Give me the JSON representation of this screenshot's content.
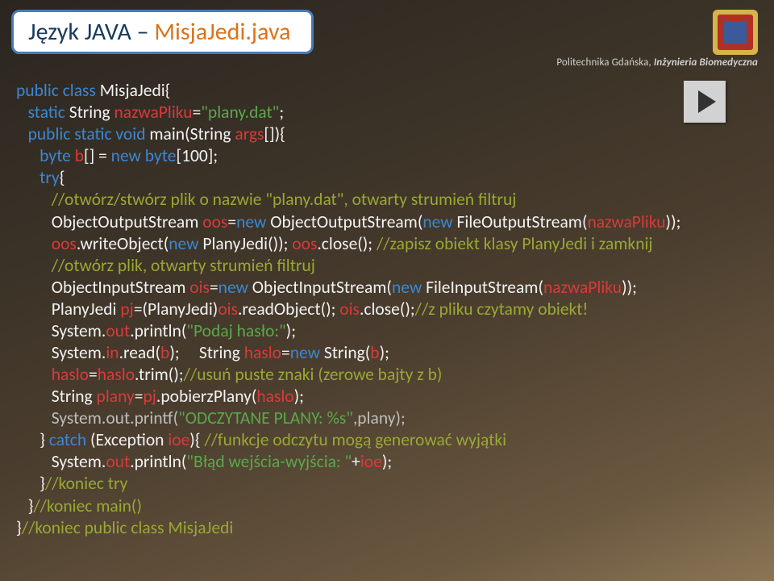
{
  "title": {
    "part1": "Język JAVA – ",
    "part2": "MisjaJedi.java"
  },
  "header": {
    "institution_prefix": "Politechnika Gdańska, ",
    "institution_italic": "Inżynieria Biomedyczna"
  },
  "code": {
    "l1a": "public class ",
    "l1b": "MisjaJedi",
    "l1c": "{",
    "l2a": "   static ",
    "l2b": "String ",
    "l2c": "nazwaPliku",
    "l2d": "=",
    "l2e": "\"plany.dat\"",
    "l2f": ";",
    "l3a": "   public static void ",
    "l3b": "main(String ",
    "l3c": "args",
    "l3d": "[]){",
    "l4a": "      byte ",
    "l4b": "b",
    "l4c": "[] = ",
    "l4d": "new byte",
    "l4e": "[100];",
    "l5a": "      try",
    "l5b": "{",
    "l6": "         //otwórz/stwórz plik o nazwie \"plany.dat\", otwarty strumień filtruj",
    "l7a": "         ObjectOutputStream ",
    "l7b": "oos",
    "l7c": "=",
    "l7d": "new ",
    "l7e": "ObjectOutputStream(",
    "l7f": "new ",
    "l7g": "FileOutputStream(",
    "l7h": "nazwaPliku",
    "l7i": "));",
    "l8a": "         oos",
    "l8b": ".writeObject(",
    "l8c": "new ",
    "l8d": "PlanyJedi()); ",
    "l8e": "oos",
    "l8f": ".close(); ",
    "l8g": "//zapisz obiekt klasy PlanyJedi i zamknij",
    "l9": "         //otwórz plik, otwarty strumień filtruj",
    "l10a": "         ObjectInputStream ",
    "l10b": "ois",
    "l10c": "=",
    "l10d": "new ",
    "l10e": "ObjectInputStream(",
    "l10f": "new ",
    "l10g": "FileInputStream(",
    "l10h": "nazwaPliku",
    "l10i": "));",
    "l11a": "         PlanyJedi ",
    "l11b": "pj",
    "l11c": "=(PlanyJedi)",
    "l11d": "ois",
    "l11e": ".readObject(); ",
    "l11f": "ois",
    "l11g": ".close();",
    "l11h": "//z pliku czytamy obiekt!",
    "l12a": "         System.",
    "l12b": "out",
    "l12c": ".println(",
    "l12d": "\"Podaj hasło:\"",
    "l12e": ");",
    "l13a": "         System.",
    "l13b": "in",
    "l13c": ".read(",
    "l13d": "b",
    "l13e": ");     String ",
    "l13f": "haslo",
    "l13g": "=",
    "l13h": "new ",
    "l13i": "String(",
    "l13j": "b",
    "l13k": ");",
    "l14a": "         haslo",
    "l14b": "=",
    "l14c": "haslo",
    "l14d": ".trim();",
    "l14e": "//usuń puste znaki (zerowe bajty z b)",
    "l15a": "         String ",
    "l15b": "plany",
    "l15c": "=",
    "l15d": "pj",
    "l15e": ".pobierzPlany(",
    "l15f": "haslo",
    "l15g": ");",
    "l16a": "         System.out.printf(",
    "l16b": "\"ODCZYTANE PLANY: %s\"",
    "l16c": ",plany);",
    "l17a": "      } ",
    "l17b": "catch ",
    "l17c": "(Exception ",
    "l17d": "ioe",
    "l17e": "){ ",
    "l17f": "//funkcje odczytu mogą generować wyjątki",
    "l18a": "         System.",
    "l18b": "out",
    "l18c": ".println(",
    "l18d": "\"Błąd wejścia-wyjścia: \"",
    "l18e": "+",
    "l18f": "ioe",
    "l18g": ");",
    "l19a": "      }",
    "l19b": "//koniec try",
    "l20a": "   }",
    "l20b": "//koniec main()",
    "l21a": "}",
    "l21b": "//koniec public class MisjaJedi"
  }
}
